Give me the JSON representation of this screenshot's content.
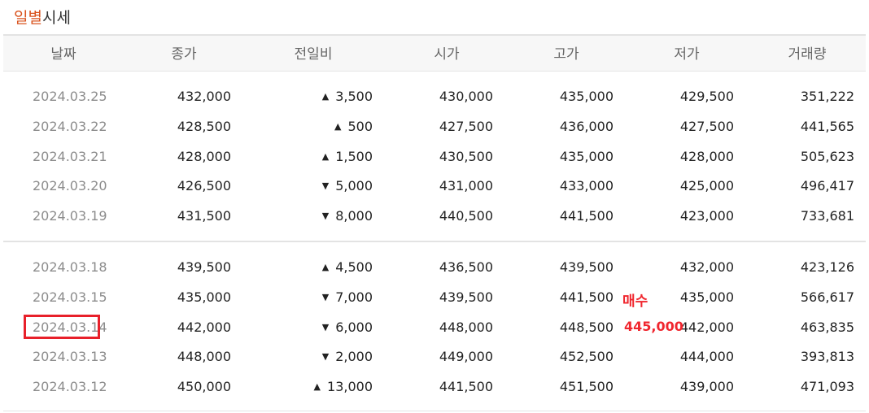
{
  "title": {
    "accent": "일별",
    "rest": "시세"
  },
  "colors": {
    "accent": "#d9531e",
    "up": "#d60000",
    "down": "#1a6ad6",
    "annotation": "#f0262e"
  },
  "headers": {
    "date": "날짜",
    "close": "종가",
    "change": "전일비",
    "open": "시가",
    "high": "고가",
    "low": "저가",
    "volume": "거래량"
  },
  "groups": [
    {
      "rows": [
        {
          "date": "2024.03.25",
          "close": "432,000",
          "dir": "up",
          "arrow": "▲",
          "change": "3,500",
          "open": "430,000",
          "high": "435,000",
          "low": "429,500",
          "volume": "351,222"
        },
        {
          "date": "2024.03.22",
          "close": "428,500",
          "dir": "up",
          "arrow": "▲",
          "change": "500",
          "open": "427,500",
          "high": "436,000",
          "low": "427,500",
          "volume": "441,565"
        },
        {
          "date": "2024.03.21",
          "close": "428,000",
          "dir": "up",
          "arrow": "▲",
          "change": "1,500",
          "open": "430,500",
          "high": "435,000",
          "low": "428,000",
          "volume": "505,623"
        },
        {
          "date": "2024.03.20",
          "close": "426,500",
          "dir": "down",
          "arrow": "▼",
          "change": "5,000",
          "open": "431,000",
          "high": "433,000",
          "low": "425,000",
          "volume": "496,417"
        },
        {
          "date": "2024.03.19",
          "close": "431,500",
          "dir": "down",
          "arrow": "▼",
          "change": "8,000",
          "open": "440,500",
          "high": "441,500",
          "low": "423,000",
          "volume": "733,681"
        }
      ]
    },
    {
      "rows": [
        {
          "date": "2024.03.18",
          "close": "439,500",
          "dir": "up",
          "arrow": "▲",
          "change": "4,500",
          "open": "436,500",
          "high": "439,500",
          "low": "432,000",
          "volume": "423,126"
        },
        {
          "date": "2024.03.15",
          "close": "435,000",
          "dir": "down",
          "arrow": "▼",
          "change": "7,000",
          "open": "439,500",
          "high": "441,500",
          "low": "435,000",
          "volume": "566,617"
        },
        {
          "date": "2024.03.14",
          "close": "442,000",
          "dir": "down",
          "arrow": "▼",
          "change": "6,000",
          "open": "448,000",
          "high": "448,500",
          "low": "442,000",
          "volume": "463,835"
        },
        {
          "date": "2024.03.13",
          "close": "448,000",
          "dir": "down",
          "arrow": "▼",
          "change": "2,000",
          "open": "449,000",
          "high": "452,500",
          "low": "444,000",
          "volume": "393,813"
        },
        {
          "date": "2024.03.12",
          "close": "450,000",
          "dir": "up",
          "arrow": "▲",
          "change": "13,000",
          "open": "441,500",
          "high": "451,500",
          "low": "439,000",
          "volume": "471,093"
        }
      ]
    }
  ],
  "annotation": {
    "label": "매수",
    "price": "445,000"
  }
}
